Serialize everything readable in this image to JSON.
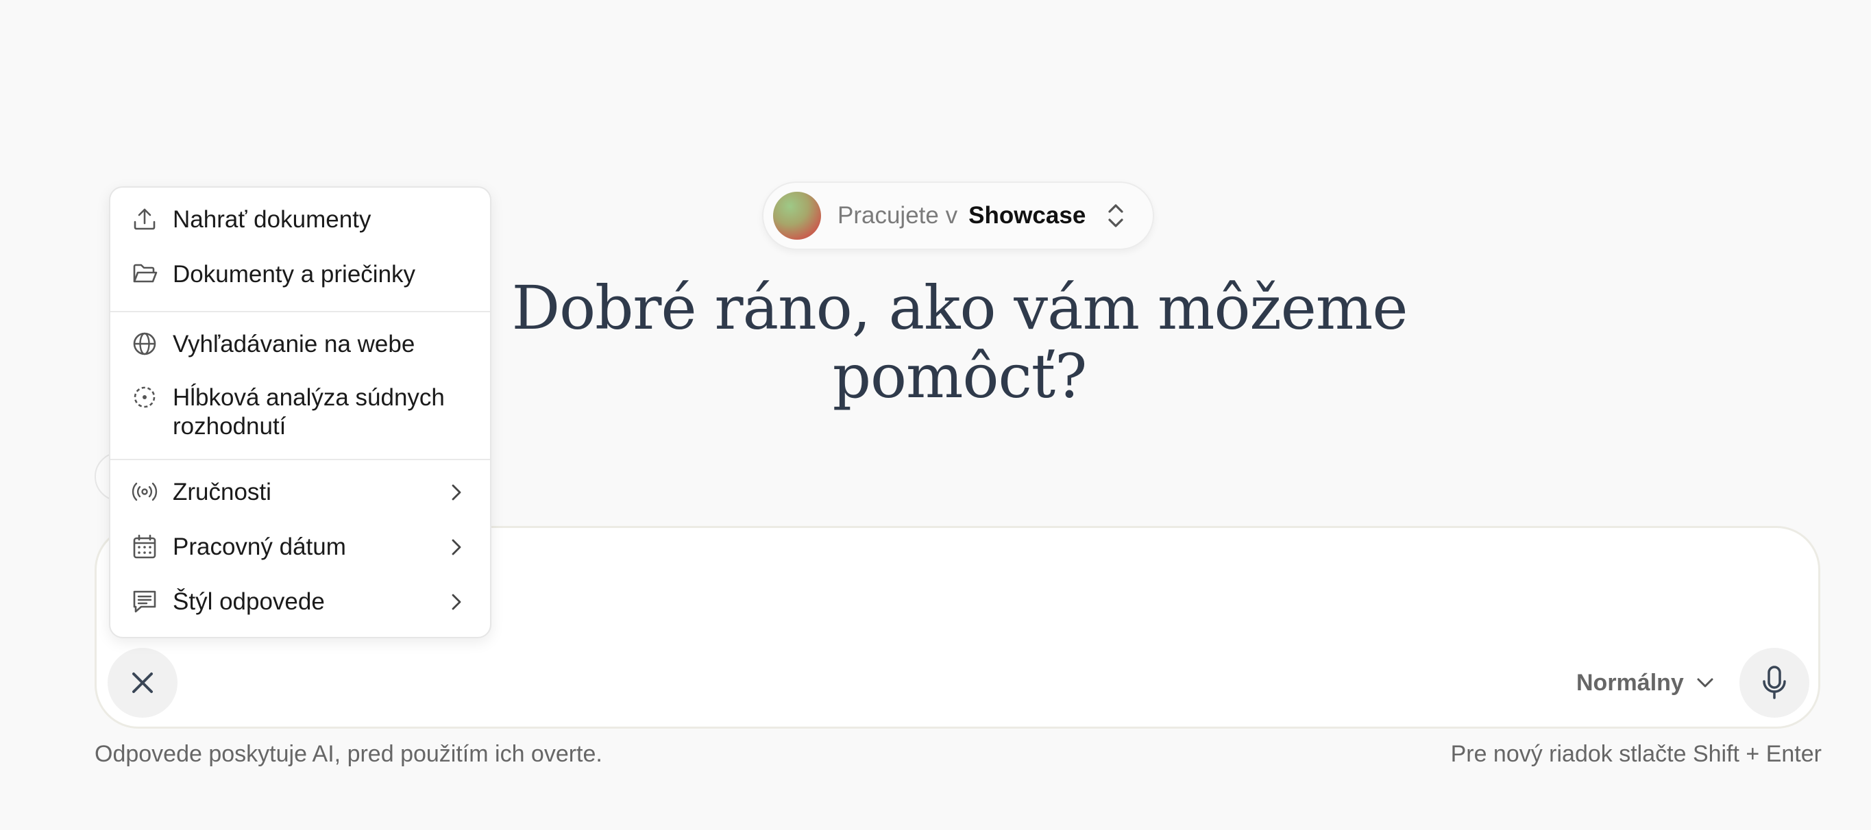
{
  "workspace": {
    "prefix": "Pracujete v",
    "name": "Showcase"
  },
  "greeting": {
    "line1": "Dobré ráno, ako vám môžeme",
    "line2": "pomôcť?"
  },
  "menu": {
    "items": [
      {
        "label": "Nahrať dokumenty",
        "icon": "upload-icon"
      },
      {
        "label": "Dokumenty a priečinky",
        "icon": "folder-open-icon"
      },
      {
        "label": "Vyhľadávanie na webe",
        "icon": "globe-icon"
      },
      {
        "label": "Hĺbková analýza súdnych rozhodnutí",
        "icon": "dashed-circle-icon"
      },
      {
        "label": "Zručnosti",
        "icon": "broadcast-icon",
        "submenu": true
      },
      {
        "label": "Pracovný dátum",
        "icon": "calendar-icon",
        "submenu": true
      },
      {
        "label": "Štýl odpovede",
        "icon": "message-lines-icon",
        "submenu": true
      }
    ]
  },
  "composer": {
    "mode": "Normálny",
    "close_icon": "close-icon",
    "mic_icon": "microphone-icon"
  },
  "footer": {
    "disclaimer": "Odpovede poskytuje AI, pred použitím ich overte.",
    "hint": "Pre nový riadok stlačte Shift + Enter"
  },
  "colors": {
    "background": "#f9f9f9",
    "heading": "#2f3a4b",
    "muted": "#666666"
  }
}
